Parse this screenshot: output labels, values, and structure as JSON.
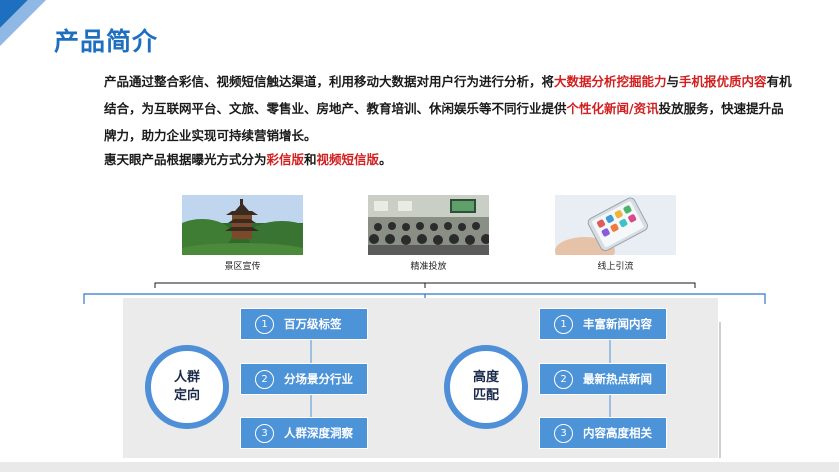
{
  "title": "产品简介",
  "intro": {
    "p1_a": "产品通过整合彩信、视频短信触达渠道，利用移动大数据对用户行为进行分析，将",
    "p1_hl1": "大数据分析挖掘能力",
    "p1_b": "与",
    "p1_hl2": "手机报优质内容",
    "p1_c": "有机结合，为互联网平台、文旅、零售业、房地产、教育培训、休闲娱乐等不同行业提供",
    "p1_hl3": "个性化新闻/资讯",
    "p1_d": "投放服务，快速提升品牌力，助力企业实现可持续营销增长。",
    "p2_a": "惠天眼产品根据曝光方式分为",
    "p2_hl1": "彩信版",
    "p2_b": "和",
    "p2_hl2": "视频短信版",
    "p2_c": "。"
  },
  "images": [
    {
      "caption": "景区宣传",
      "icon": "pagoda-photo"
    },
    {
      "caption": "精准投放",
      "icon": "classroom-photo"
    },
    {
      "caption": "线上引流",
      "icon": "smartphone-photo"
    }
  ],
  "diagram": {
    "left": {
      "circle": "人群\n定向",
      "items": [
        {
          "num": "1",
          "label": "百万级标签"
        },
        {
          "num": "2",
          "label": "分场景分行业"
        },
        {
          "num": "3",
          "label": "人群深度洞察"
        }
      ]
    },
    "right": {
      "circle": "高度\n匹配",
      "items": [
        {
          "num": "1",
          "label": "丰富新闻内容"
        },
        {
          "num": "2",
          "label": "最新热点新闻"
        },
        {
          "num": "3",
          "label": "内容高度相关"
        }
      ]
    }
  },
  "colors": {
    "title": "#1f6fc0",
    "highlight": "#d21f1f",
    "box": "#4d93d8",
    "circle_border": "#4f8fd8",
    "panel": "#ebebeb",
    "corner": "#1f6fc0"
  }
}
